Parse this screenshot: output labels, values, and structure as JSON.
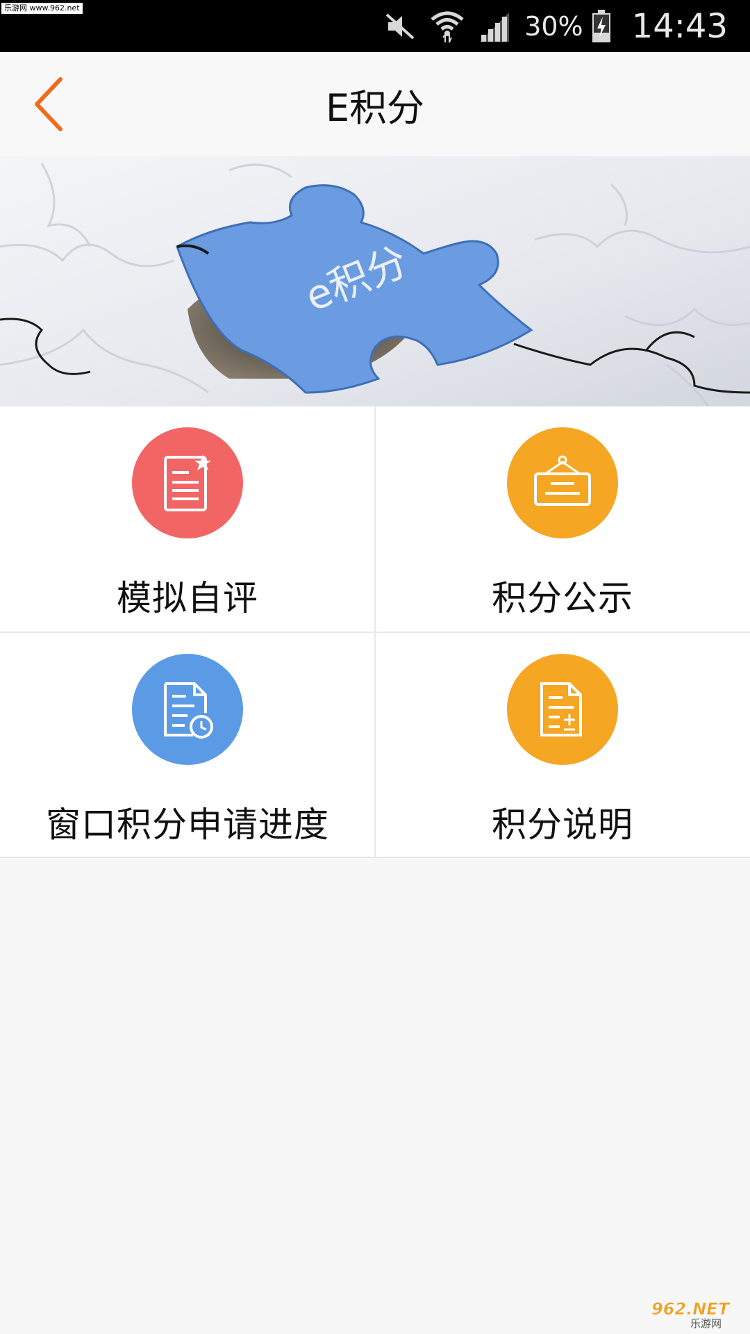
{
  "status_bar": {
    "watermark": "乐游网 www.962.net",
    "battery_percent": "30%",
    "time": "14:43",
    "icons": [
      "mute-icon",
      "wifi-icon",
      "signal-icon",
      "battery-charging-icon"
    ]
  },
  "header": {
    "title": "E积分",
    "back_icon": "chevron-left-icon",
    "accent_color": "#f26a1b"
  },
  "banner": {
    "puzzle_text": "e积分",
    "puzzle_color": "#6b9be0"
  },
  "menu": [
    {
      "label": "模拟自评",
      "icon": "document-star-icon",
      "color": "#f26565"
    },
    {
      "label": "积分公示",
      "icon": "notice-board-icon",
      "color": "#f5a623"
    },
    {
      "label": "窗口积分申请进度",
      "icon": "document-clock-icon",
      "color": "#5b9be6"
    },
    {
      "label": "积分说明",
      "icon": "document-plus-minus-icon",
      "color": "#f5a623"
    }
  ],
  "watermark_bottom": {
    "main": "962.NET",
    "sub": "乐游网"
  }
}
